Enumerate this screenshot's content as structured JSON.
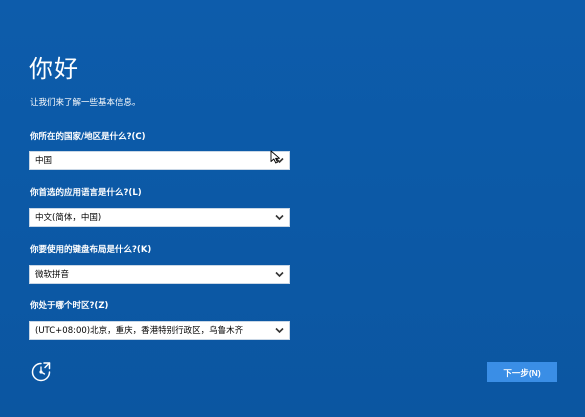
{
  "page": {
    "title": "你好",
    "subtitle": "让我们来了解一些基本信息。"
  },
  "fields": [
    {
      "label": "你所在的国家/地区是什么?(C)",
      "value": "中国"
    },
    {
      "label": "你首选的应用语言是什么?(L)",
      "value": "中文(简体，中国)"
    },
    {
      "label": "你要使用的键盘布局是什么?(K)",
      "value": "微软拼音"
    },
    {
      "label": "你处于哪个时区?(Z)",
      "value": "(UTC+08:00)北京，重庆，香港特别行政区，乌鲁木齐"
    }
  ],
  "footer": {
    "accessibility_icon": "ease-of-access-icon",
    "next_label": "下一步(N)"
  },
  "icons": {
    "dropdown": "chevron-down-icon",
    "pointer": "mouse-cursor-icon"
  },
  "colors": {
    "background": "#0c5aa6",
    "button": "#3a8ee6",
    "text": "#ffffff"
  }
}
